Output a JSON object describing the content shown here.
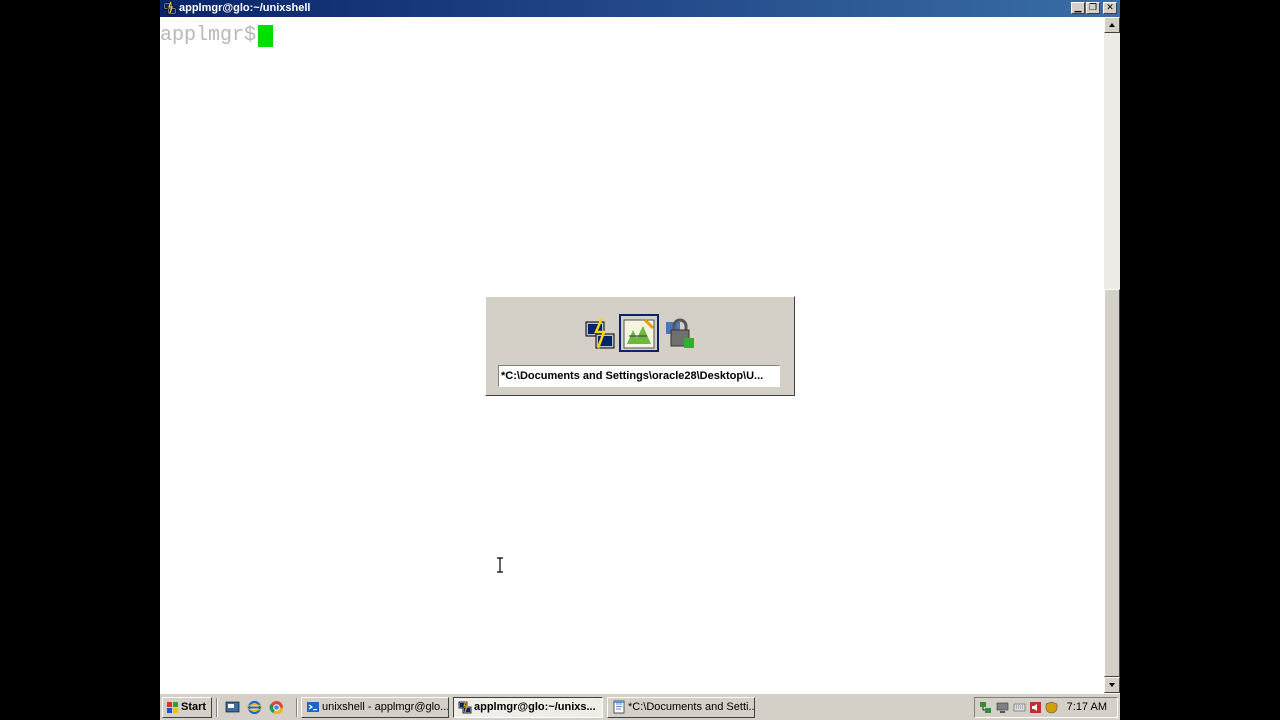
{
  "window": {
    "title": "applmgr@glo:~/unixshell",
    "controls": {
      "minimize": "▁",
      "restore": "❐",
      "close": "✕"
    }
  },
  "terminal": {
    "prompt": "applmgr$",
    "cursor_color": "#00e000"
  },
  "switcher": {
    "icons": [
      "putty-icon",
      "editor-icon",
      "security-icon"
    ],
    "selected_index": 1,
    "label": "*C:\\Documents and Settings\\oracle28\\Desktop\\U..."
  },
  "taskbar": {
    "start_label": "Start",
    "quick_launch": [
      "show-desktop-icon",
      "ie-icon",
      "browser-icon"
    ],
    "tasks": [
      {
        "label": "unixshell - applmgr@glo....",
        "icon": "terminal-icon",
        "active": false
      },
      {
        "label": "applmgr@glo:~/unixs...",
        "icon": "putty-icon",
        "active": true
      },
      {
        "label": "*C:\\Documents and Setti...",
        "icon": "notepad-icon",
        "active": false
      }
    ],
    "tray_icons": [
      "network-icon",
      "monitor-icon",
      "keyboard-icon",
      "volume-icon",
      "shield-icon"
    ],
    "clock": "7:17 AM"
  }
}
